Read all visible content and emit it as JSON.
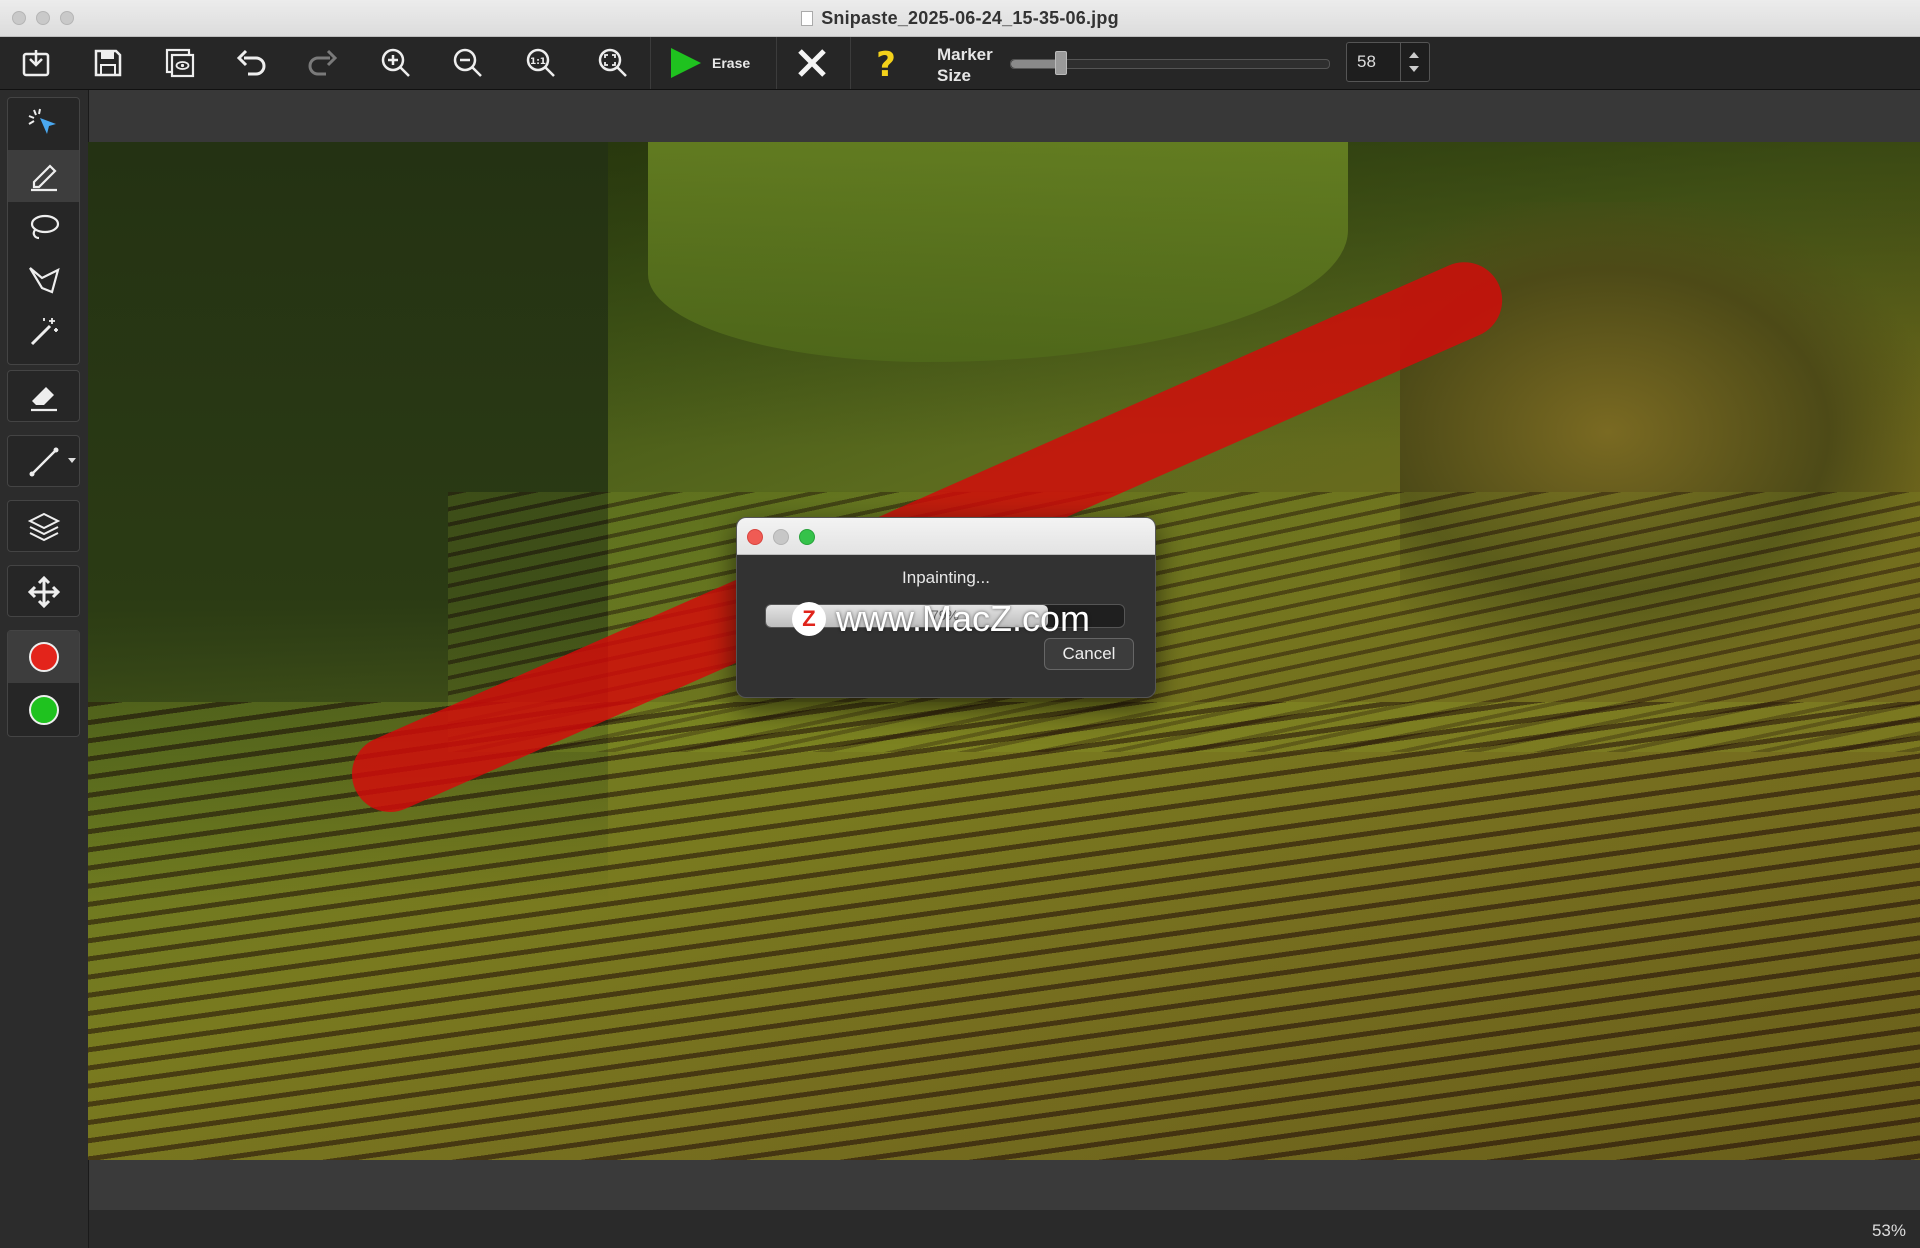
{
  "window": {
    "title": "Snipaste_2025-06-24_15-35-06.jpg"
  },
  "toolbar": {
    "erase_label": "Erase",
    "marker_label_line1": "Marker",
    "marker_label_line2": "Size",
    "marker_size": "58",
    "marker_size_fraction": 0.16,
    "icons": [
      "open-icon",
      "save-icon",
      "save-as-icon",
      "undo-icon",
      "redo-icon",
      "zoom-in-icon",
      "zoom-out-icon",
      "actual-size-icon",
      "fit-icon",
      "play-icon",
      "close-icon",
      "help-icon"
    ]
  },
  "tools": [
    "select-icon",
    "marker-icon",
    "lasso-icon",
    "polygon-lasso-icon",
    "magic-wand-icon",
    "eraser-icon",
    "line-icon",
    "layers-icon",
    "move-icon"
  ],
  "colors": {
    "marker_red": "#e3241b",
    "marker_green": "#1fc21f",
    "stroke": "#d60a0a",
    "erase_accent": "#1fc21f",
    "help_accent": "#f3d11a"
  },
  "dialog": {
    "message": "Inpainting...",
    "progress_text": "79%",
    "progress_fraction": 0.79,
    "cancel_label": "Cancel"
  },
  "watermark": {
    "badge": "Z",
    "text": "www.MacZ.com"
  },
  "status": {
    "zoom": "53%"
  }
}
